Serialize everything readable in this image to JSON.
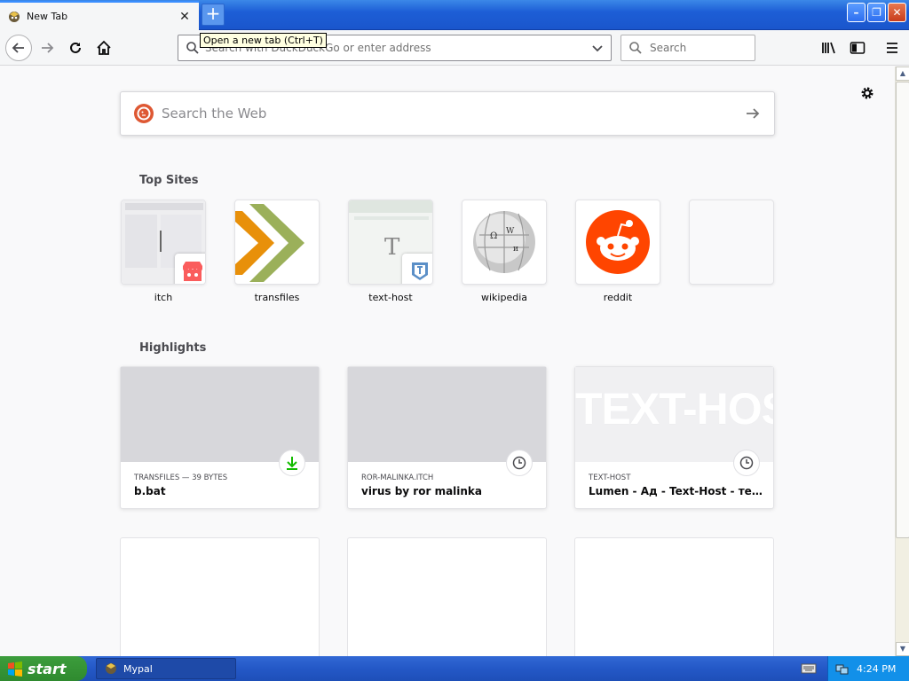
{
  "window": {
    "tab_title": "New Tab",
    "newtab_tooltip": "Open a new tab (Ctrl+T)"
  },
  "toolbar": {
    "url_placeholder": "Search with DuckDuckGo or enter address",
    "search_placeholder": "Search"
  },
  "newtab": {
    "web_search_placeholder": "Search the Web",
    "top_sites_title": "Top Sites",
    "top_sites": [
      {
        "label": "itch"
      },
      {
        "label": "transfiles"
      },
      {
        "label": "text-host"
      },
      {
        "label": "wikipedia"
      },
      {
        "label": "reddit"
      },
      {
        "label": ""
      }
    ],
    "highlights_title": "Highlights",
    "highlights": [
      {
        "context": "TRANSFILES — 39 BYTES",
        "title": "b.bat",
        "icon": "download-icon"
      },
      {
        "context": "ROR-MALINKA.ITCH",
        "title": "virus by ror malinka",
        "icon": "clock-icon"
      },
      {
        "context": "TEXT-HOST",
        "title": "Lumen - Ад - Text-Host - тексто...",
        "icon": "clock-icon",
        "image_text": "TEXT-HOST"
      }
    ]
  },
  "taskbar": {
    "start_label": "start",
    "task_label": "Mypal",
    "clock": "4:24 PM"
  },
  "colors": {
    "reddit": "#ff4500",
    "download_green": "#12bc00",
    "transfiles_orange": "#e8900a",
    "transfiles_green": "#9bb05a"
  }
}
